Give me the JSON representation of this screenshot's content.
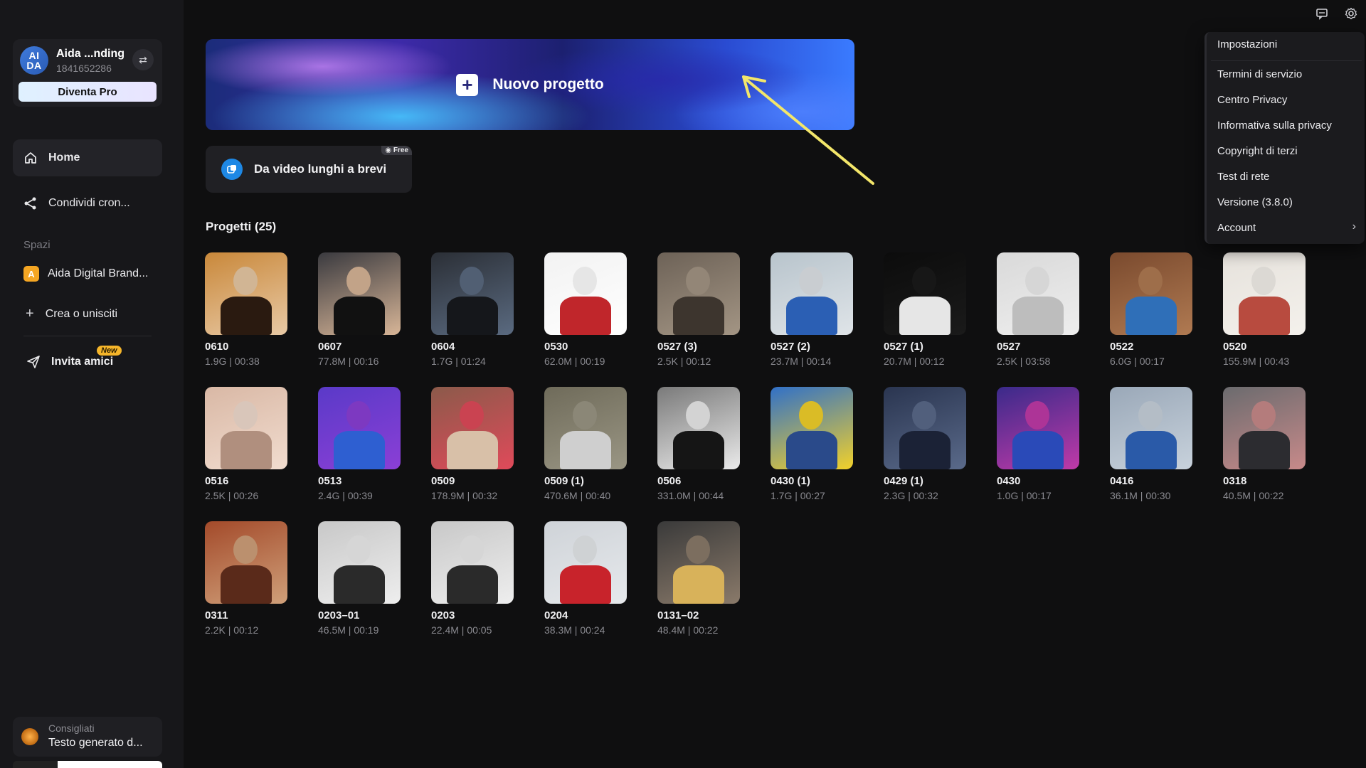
{
  "account": {
    "avatar_text": "AI DA",
    "name": "Aida ...nding",
    "id": "1841652286",
    "pro_button": "Diventa Pro"
  },
  "sidebar": {
    "items": [
      {
        "label": "Home",
        "icon": "home-icon"
      },
      {
        "label": "Condividi cron...",
        "icon": "share-icon"
      }
    ],
    "spaces_label": "Spazi",
    "space": {
      "badge": "A",
      "label": "Aida Digital Brand..."
    },
    "create_label": "Crea o unisciti",
    "invite_label": "Invita amici",
    "invite_badge": "New",
    "tips": {
      "label": "Consigliati",
      "text": "Testo generato d..."
    }
  },
  "main": {
    "new_project_label": "Nuovo progetto",
    "short_video_label": "Da video lunghi a brevi",
    "free_badge": "Free",
    "projects_title": "Progetti  (25)",
    "projects": [
      {
        "name": "0610",
        "meta": "1.9G | 00:38"
      },
      {
        "name": "0607",
        "meta": "77.8M | 00:16"
      },
      {
        "name": "0604",
        "meta": "1.7G | 01:24"
      },
      {
        "name": "0530",
        "meta": "62.0M | 00:19"
      },
      {
        "name": "0527 (3)",
        "meta": "2.5K | 00:12"
      },
      {
        "name": "0527 (2)",
        "meta": "23.7M | 00:14"
      },
      {
        "name": "0527 (1)",
        "meta": "20.7M | 00:12"
      },
      {
        "name": "0527",
        "meta": "2.5K | 03:58"
      },
      {
        "name": "0522",
        "meta": "6.0G | 00:17"
      },
      {
        "name": "0520",
        "meta": "155.9M | 00:43"
      },
      {
        "name": "0516",
        "meta": "2.5K | 00:26"
      },
      {
        "name": "0513",
        "meta": "2.4G | 00:39"
      },
      {
        "name": "0509",
        "meta": "178.9M | 00:32"
      },
      {
        "name": "0509 (1)",
        "meta": "470.6M | 00:40"
      },
      {
        "name": "0506",
        "meta": "331.0M | 00:44"
      },
      {
        "name": "0430 (1)",
        "meta": "1.7G | 00:27"
      },
      {
        "name": "0429 (1)",
        "meta": "2.3G | 00:32"
      },
      {
        "name": "0430",
        "meta": "1.0G | 00:17"
      },
      {
        "name": "0416",
        "meta": "36.1M | 00:30"
      },
      {
        "name": "0318",
        "meta": "40.5M | 00:22"
      },
      {
        "name": "0311",
        "meta": "2.2K | 00:12"
      },
      {
        "name": "0203–01",
        "meta": "46.5M | 00:19"
      },
      {
        "name": "0203",
        "meta": "22.4M | 00:05"
      },
      {
        "name": "0204",
        "meta": "38.3M | 00:24"
      },
      {
        "name": "0131–02",
        "meta": "48.4M | 00:22"
      }
    ]
  },
  "menu": {
    "items": [
      "Impostazioni",
      "Termini di servizio",
      "Centro Privacy",
      "Informativa sulla privacy",
      "Copyright di terzi",
      "Test di rete",
      "Versione (3.8.0)",
      "Account"
    ]
  },
  "topbar": {
    "icons": [
      "feedback-icon",
      "settings-icon"
    ]
  },
  "colors": {
    "background": "#0f0f10",
    "sidebar": "#17171a",
    "accent_arrow": "#f3e66a",
    "free_badge": "#3b3b42"
  }
}
